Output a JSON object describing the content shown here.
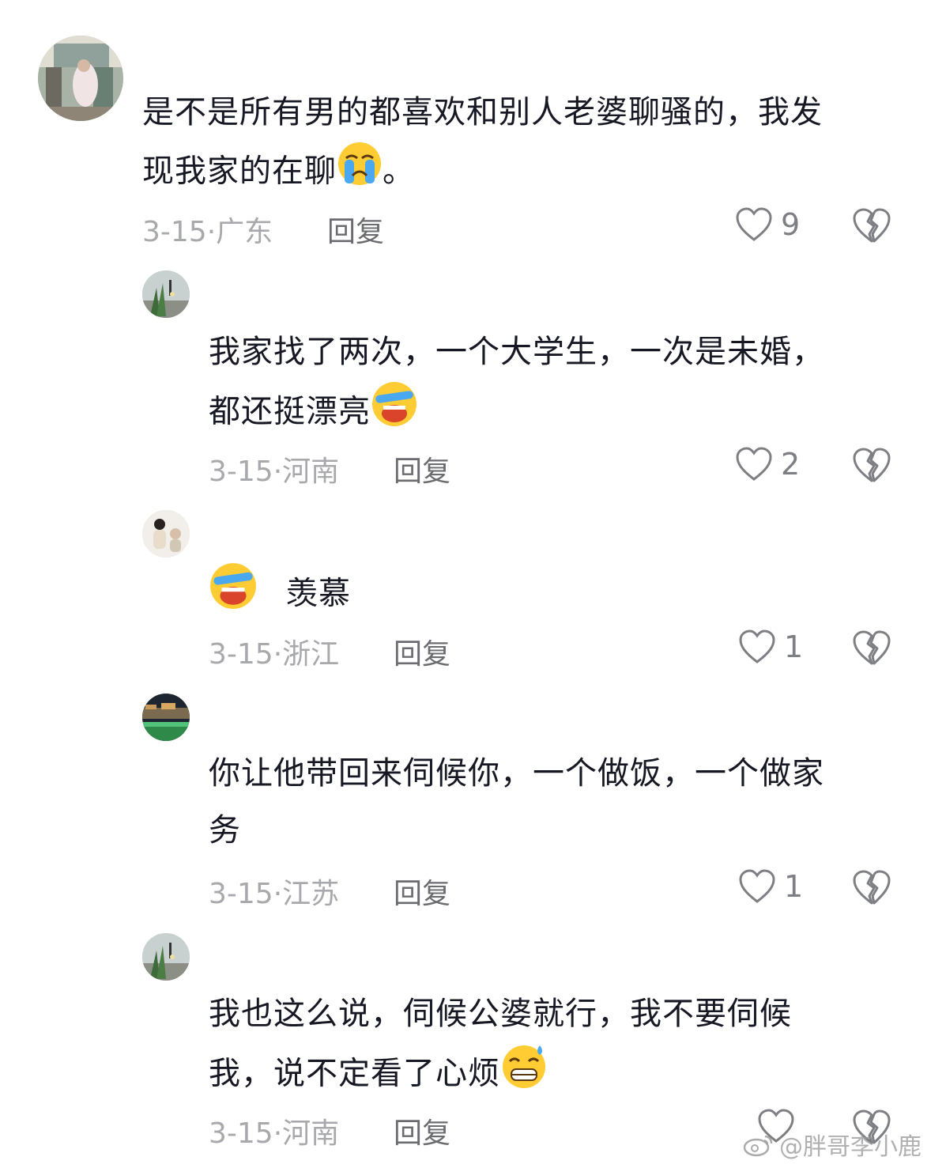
{
  "comments": [
    {
      "text_line1": "是不是所有男的都喜欢和别人老婆聊骚的，我发",
      "text_line2": "现我家的在聊",
      "text_tail": "。",
      "emoji": "crying-face",
      "date": "3-15",
      "location": "广东",
      "reply": "回复",
      "likes": "9"
    },
    {
      "text_line1": "我家找了两次，一个大学生，一次是未婚，",
      "text_line2": "都还挺漂亮",
      "emoji": "loudly-crying-face",
      "date": "3-15",
      "location": "河南",
      "reply": "回复",
      "likes": "2"
    },
    {
      "text_line1": "羡慕",
      "emoji": "loudly-crying-face",
      "date": "3-15",
      "location": "浙江",
      "reply": "回复",
      "likes": "1"
    },
    {
      "text_line1": "你让他带回来伺候你，一个做饭，一个做家",
      "text_line2": "务",
      "date": "3-15",
      "location": "江苏",
      "reply": "回复",
      "likes": "1"
    },
    {
      "text_line1": "我也这么说，伺候公婆就行，我不要伺候",
      "text_line2": "我，说不定看了心烦",
      "emoji": "grinning-sweat-face",
      "date": "3-15",
      "location": "河南",
      "reply": "回复",
      "likes": ""
    }
  ],
  "watermark": "@胖哥李小鹿",
  "icons": {
    "like": "heart-outline-icon",
    "dislike": "broken-heart-icon",
    "watermark": "weibo-logo-icon"
  }
}
